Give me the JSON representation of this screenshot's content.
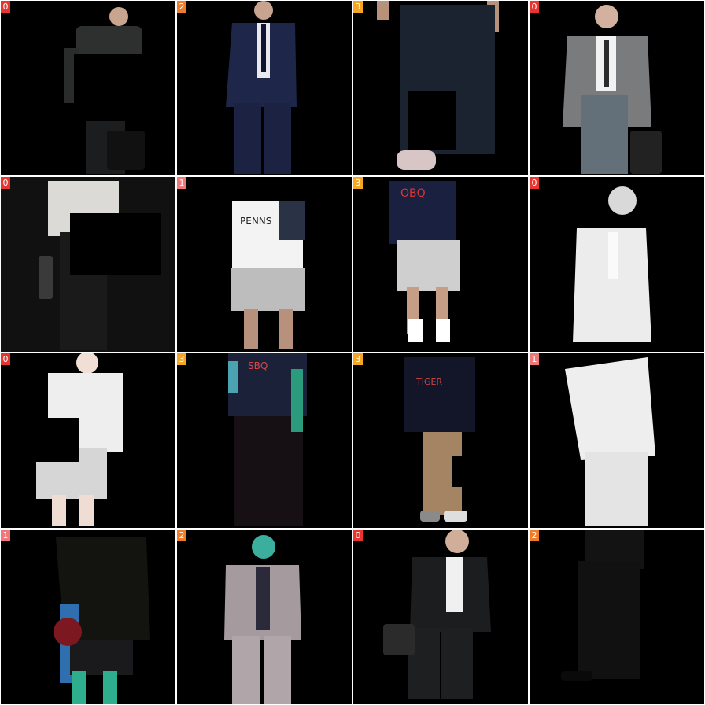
{
  "tiles": [
    {
      "label": "0",
      "badge_color": "#e8352f"
    },
    {
      "label": "2",
      "badge_color": "#f07c2a"
    },
    {
      "label": "3",
      "badge_color": "#f5a623"
    },
    {
      "label": "0",
      "badge_color": "#e8352f"
    },
    {
      "label": "0",
      "badge_color": "#e8352f"
    },
    {
      "label": "1",
      "badge_color": "#f0787a"
    },
    {
      "label": "3",
      "badge_color": "#f5a623"
    },
    {
      "label": "0",
      "badge_color": "#e8352f"
    },
    {
      "label": "0",
      "badge_color": "#e8352f"
    },
    {
      "label": "3",
      "badge_color": "#f5a623"
    },
    {
      "label": "3",
      "badge_color": "#f5a623"
    },
    {
      "label": "1",
      "badge_color": "#f0787a"
    },
    {
      "label": "1",
      "badge_color": "#f0787a"
    },
    {
      "label": "2",
      "badge_color": "#f07c2a"
    },
    {
      "label": "0",
      "badge_color": "#e8352f"
    },
    {
      "label": "2",
      "badge_color": "#f07c2a"
    }
  ]
}
